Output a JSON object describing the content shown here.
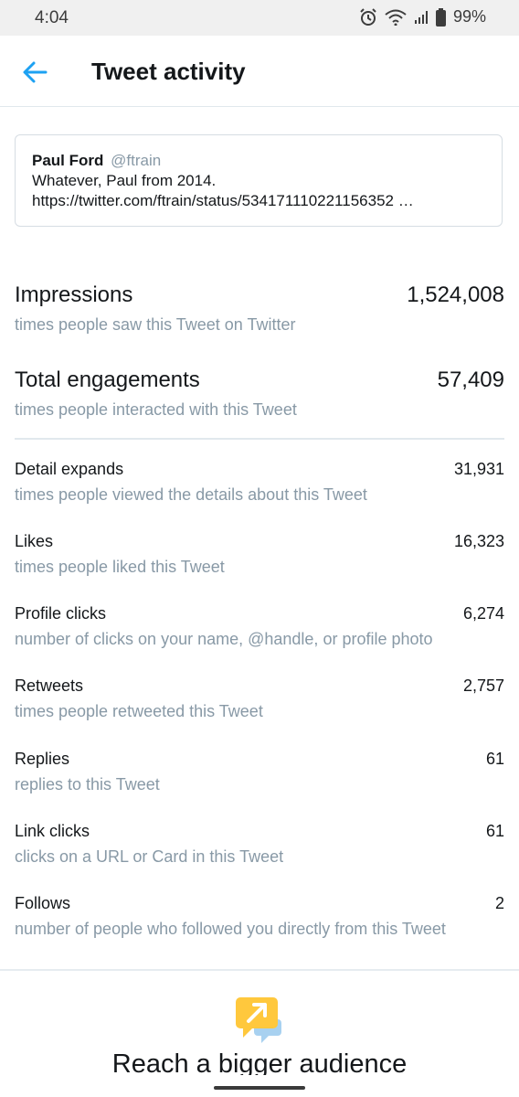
{
  "status_bar": {
    "time": "4:04",
    "battery": "99%",
    "icons": [
      "alarm-icon",
      "wifi-icon",
      "signal-icon",
      "battery-icon"
    ]
  },
  "header": {
    "title": "Tweet activity",
    "back_icon": "back-arrow-icon",
    "accent_color": "#1da1f2"
  },
  "tweet": {
    "name": "Paul Ford",
    "handle": "@ftrain",
    "line1": "Whatever, Paul from 2014.",
    "line2": "https://twitter.com/ftrain/status/534171110221156352 …"
  },
  "primary_stats": [
    {
      "label": "Impressions",
      "value": "1,524,008",
      "desc": "times people saw this Tweet on Twitter"
    },
    {
      "label": "Total engagements",
      "value": "57,409",
      "desc": "times people interacted with this Tweet"
    }
  ],
  "stats": [
    {
      "label": "Detail expands",
      "value": "31,931",
      "desc": "times people viewed the details about this Tweet"
    },
    {
      "label": "Likes",
      "value": "16,323",
      "desc": "times people liked this Tweet"
    },
    {
      "label": "Profile clicks",
      "value": "6,274",
      "desc": "number of clicks on your name, @handle, or profile photo"
    },
    {
      "label": "Retweets",
      "value": "2,757",
      "desc": "times people retweeted this Tweet"
    },
    {
      "label": "Replies",
      "value": "61",
      "desc": "replies to this Tweet"
    },
    {
      "label": "Link clicks",
      "value": "61",
      "desc": "clicks on a URL or Card in this Tweet"
    },
    {
      "label": "Follows",
      "value": "2",
      "desc": "number of people who followed you directly from this Tweet"
    }
  ],
  "promo": {
    "title": "Reach a bigger audience",
    "icon": "promote-icon"
  }
}
